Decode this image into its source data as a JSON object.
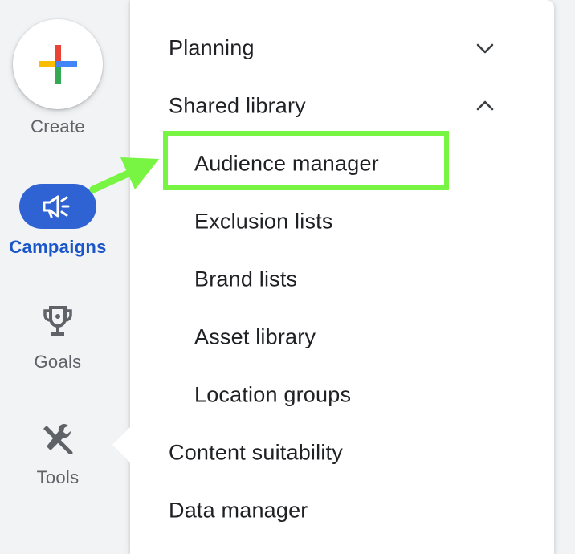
{
  "rail": {
    "create_label": "Create",
    "campaigns_label": "Campaigns",
    "goals_label": "Goals",
    "tools_label": "Tools",
    "create_icon": "plus-multicolor-icon",
    "campaigns_icon": "megaphone-icon",
    "goals_icon": "trophy-icon",
    "tools_icon": "tools-icon"
  },
  "menu": {
    "planning": "Planning",
    "shared_library": "Shared library",
    "shared_library_items": [
      "Audience manager",
      "Exclusion lists",
      "Brand lists",
      "Asset library",
      "Location groups"
    ],
    "content_suitability": "Content suitability",
    "data_manager": "Data manager",
    "highlighted_item": "Audience manager"
  },
  "colors": {
    "accent_blue": "#2f63d3",
    "active_text": "#1a56c8",
    "highlight_green": "#78f542",
    "google_red": "#ea4335",
    "google_blue": "#4285f4",
    "google_green": "#34a853",
    "google_yellow": "#fbbc04"
  }
}
